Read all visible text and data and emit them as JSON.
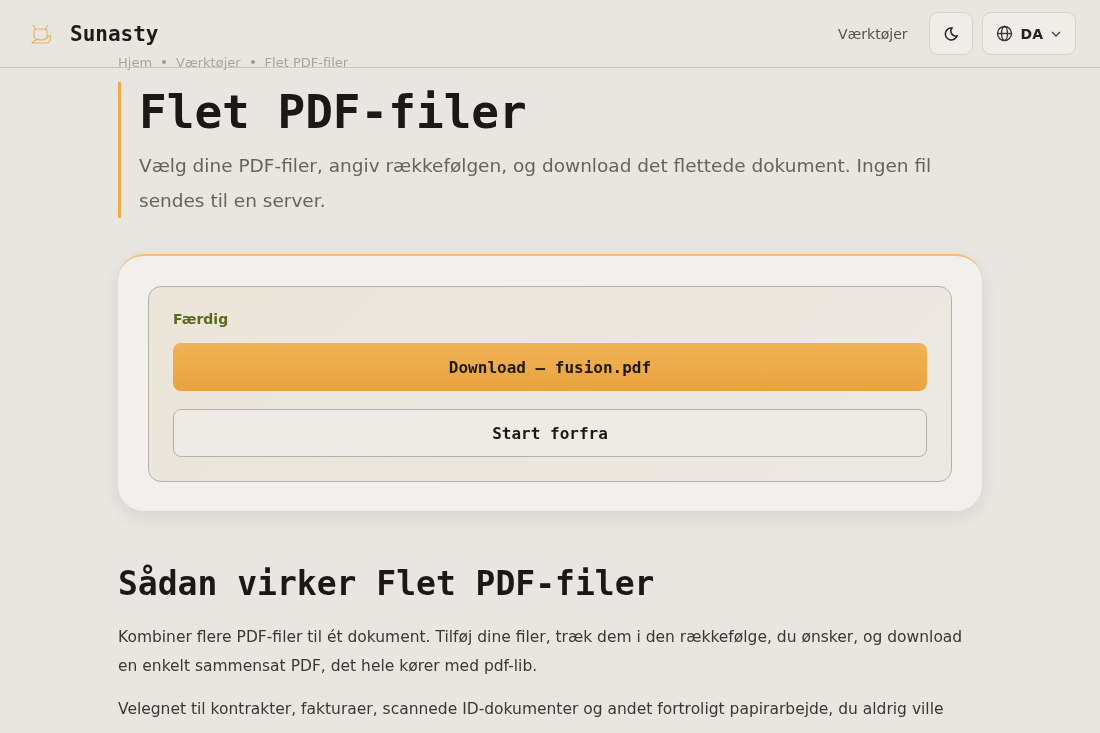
{
  "header": {
    "brand": "Sunasty",
    "nav_link": "Værktøjer",
    "language": "DA"
  },
  "breadcrumb": [
    "Hjem",
    "Værktøjer",
    "Flet PDF-filer"
  ],
  "hero": {
    "title": "Flet PDF-filer",
    "subtitle": "Vælg dine PDF-filer, angiv rækkefølgen, og download det flettede dokument. Ingen fil sendes til en server."
  },
  "result": {
    "status": "Færdig",
    "download_button": "Download — fusion.pdf",
    "restart_button": "Start forfra"
  },
  "about": {
    "heading": "Sådan virker Flet PDF-filer",
    "paragraphs": [
      "Kombiner flere PDF-filer til ét dokument. Tilføj dine filer, træk dem i den rækkefølge, du ønsker, og download en enkelt sammensat PDF, det hele kører med pdf-lib.",
      "Velegnet til kontrakter, fakturaer, scannede ID-dokumenter og andet fortroligt papirarbejde, du aldrig ville"
    ]
  }
}
